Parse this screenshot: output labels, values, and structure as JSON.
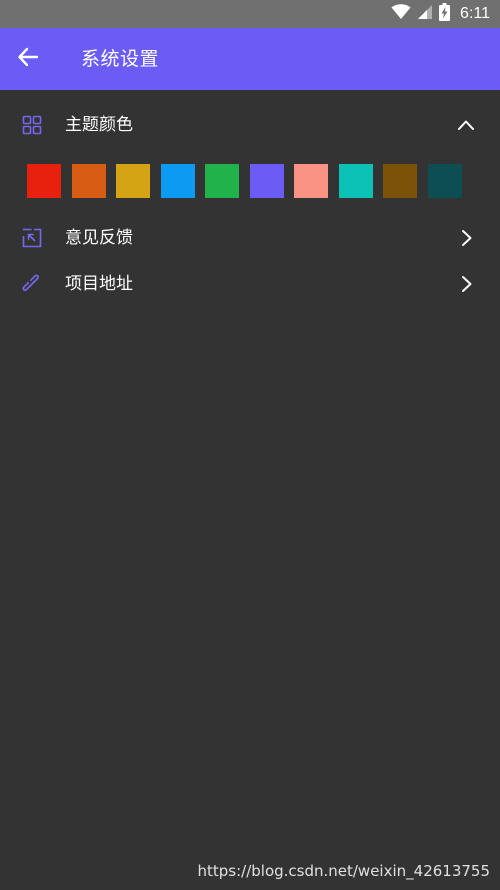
{
  "status_bar": {
    "time": "6:11",
    "icons": [
      "wifi-icon",
      "signal-icon",
      "battery-charging-icon"
    ]
  },
  "app_bar": {
    "title": "系统设置",
    "back_icon": "arrow-left-icon",
    "background": "#6a5cf5"
  },
  "settings": {
    "theme": {
      "label": "主题颜色",
      "icon": "grid-icon",
      "trailing_icon": "chevron-up-icon",
      "expanded": true,
      "colors": [
        "#e8210f",
        "#d85d14",
        "#d4a414",
        "#0d9af2",
        "#21b24c",
        "#6a5cf5",
        "#fb9384",
        "#0cc2b6",
        "#7b5208",
        "#0d4e52"
      ]
    },
    "feedback": {
      "label": "意见反馈",
      "icon": "feedback-icon",
      "trailing_icon": "chevron-right-icon"
    },
    "project": {
      "label": "项目地址",
      "icon": "link-icon",
      "trailing_icon": "chevron-right-icon"
    }
  },
  "watermark": "https://blog.csdn.net/weixin_42613755",
  "colors": {
    "background": "#333333",
    "status_bar": "#707070",
    "accent_icon": "#7568f0"
  }
}
